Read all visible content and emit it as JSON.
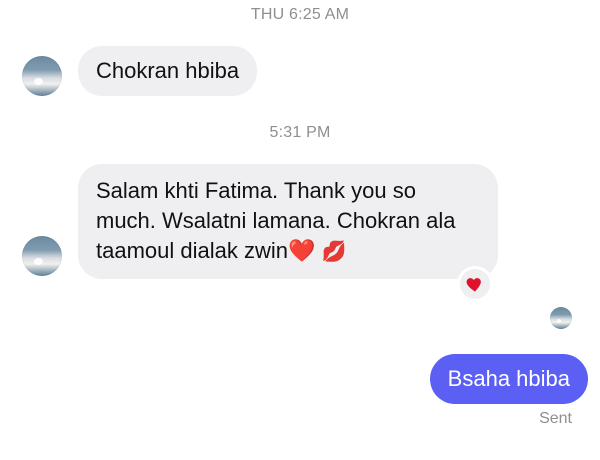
{
  "timestamps": [
    "THU 6:25 AM",
    "5:31 PM"
  ],
  "messages": [
    {
      "direction": "incoming",
      "text": "Chokran hbiba"
    },
    {
      "direction": "incoming",
      "text": "Salam khti Fatima. Thank you so much. Wsalatni lamana. Chokran ala taamoul dialak zwin",
      "emojis": [
        "❤️",
        "💋"
      ]
    },
    {
      "direction": "outgoing",
      "text": "Bsaha hbiba"
    }
  ],
  "reaction": {
    "emoji": "❤️",
    "icon": "heart-icon"
  },
  "status": "Sent",
  "colors": {
    "incoming_bubble": "#efeff1",
    "outgoing_bubble": "#5b5ff3",
    "heart": "#e0122c",
    "timestamp": "#8e8e93"
  }
}
